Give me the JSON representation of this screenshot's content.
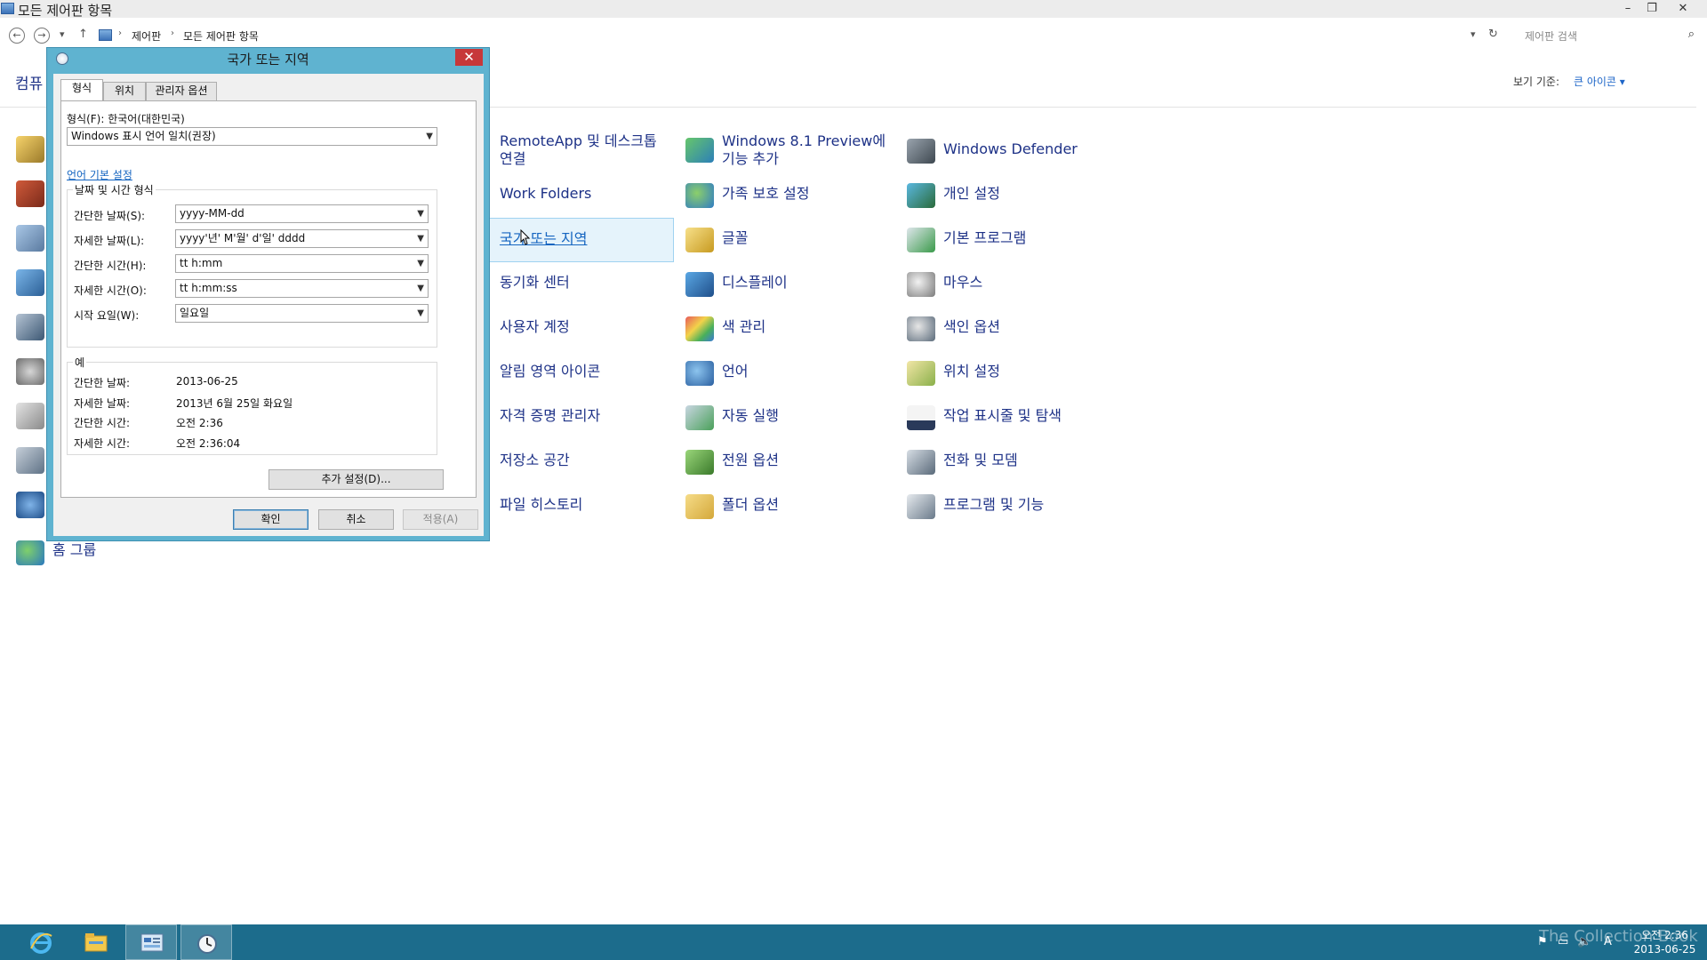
{
  "window": {
    "title": "모든 제어판 항목",
    "minimize_glyph": "–",
    "restore_glyph": "❐",
    "close_glyph": "✕"
  },
  "address_bar": {
    "back_glyph": "←",
    "forward_glyph": "→",
    "recent_glyph": "▾",
    "up_glyph": "↑",
    "crumb_1": "제어판",
    "crumb_2": "모든 제어판 항목",
    "sep": "›",
    "dropdown_glyph": "▾",
    "refresh_glyph": "↻",
    "search_placeholder": "제어판 검색",
    "search_glyph": "⌕"
  },
  "header": {
    "heading_partial": "컴퓨",
    "view_by_label": "보기 기준:",
    "view_by_value": "큰 아이콘 ▾"
  },
  "items": {
    "col1": [
      "RemoteApp 및 데스크톱",
      "연결",
      "Work Folders",
      "국가 또는 지역",
      "동기화 센터",
      "사용자 계정",
      "알림 영역 아이콘",
      "자격 증명 관리자",
      "저장소 공간",
      "파일 히스토리"
    ],
    "col2": [
      "Windows 8.1 Preview에",
      "기능 추가",
      "가족 보호 설정",
      "글꼴",
      "디스플레이",
      "색 관리",
      "언어",
      "자동 실행",
      "전원 옵션",
      "폴더 옵션"
    ],
    "col3": [
      "Windows Defender",
      "개인 설정",
      "기본 프로그램",
      "마우스",
      "색인 옵션",
      "위치 설정",
      "작업 표시줄 및 탐색",
      "전화 및 모뎀",
      "프로그램 및 기능"
    ],
    "left_last": "홈 그룹"
  },
  "dialog": {
    "title": "국가 또는 지역",
    "close_glyph": "✕",
    "tabs": [
      "형식",
      "위치",
      "관리자 옵션"
    ],
    "format_label": "형식(F): 한국어(대한민국)",
    "format_value": "Windows 표시 언어 일치(권장)",
    "lang_link": "언어 기본 설정",
    "datetime_group": "날짜 및 시간 형식",
    "short_date_label": "간단한 날짜(S):",
    "short_date_value": "yyyy-MM-dd",
    "long_date_label": "자세한 날짜(L):",
    "long_date_value": "yyyy'년' M'월' d'일' dddd",
    "short_time_label": "간단한 시간(H):",
    "short_time_value": "tt h:mm",
    "long_time_label": "자세한 시간(O):",
    "long_time_value": "tt h:mm:ss",
    "first_day_label": "시작 요일(W):",
    "first_day_value": "일요일",
    "example_group": "예",
    "ex_short_date_label": "간단한 날짜:",
    "ex_short_date_value": "2013-06-25",
    "ex_long_date_label": "자세한 날짜:",
    "ex_long_date_value": "2013년 6월 25일 화요일",
    "ex_short_time_label": "간단한 시간:",
    "ex_short_time_value": "오전 2:36",
    "ex_long_time_label": "자세한 시간:",
    "ex_long_time_value": "오전 2:36:04",
    "more_settings": "추가 설정(D)...",
    "ok": "확인",
    "cancel": "취소",
    "apply": "적용(A)",
    "combo_arrow": "▼"
  },
  "taskbar": {
    "watermark": "The Collection Book",
    "tray_ime": "A",
    "tray_flag": "⚑",
    "tray_network": "▭",
    "tray_volume": "🔈",
    "clock_time": "오전 2:36",
    "clock_date": "2013-06-25"
  },
  "colors": {
    "link_blue": "#1e3287",
    "dialog_frame": "#5fb3d0",
    "taskbar": "#1c6c8c",
    "close_red": "#c7383a"
  }
}
